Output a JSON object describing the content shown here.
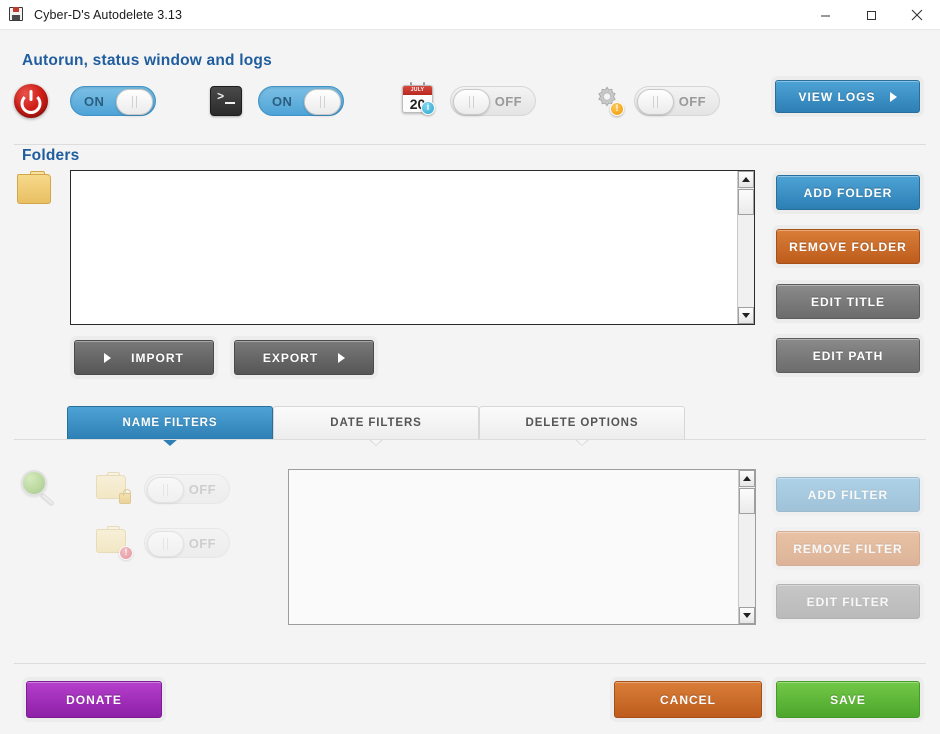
{
  "window": {
    "title": "Cyber-D's Autodelete 3.13",
    "app_icon": "floppy-disk-icon",
    "controls": {
      "minimize": "minimize-icon",
      "maximize": "maximize-icon",
      "close": "close-icon"
    }
  },
  "header": {
    "title": "Autorun, status window and logs",
    "items": [
      {
        "icon": "power-icon",
        "toggle_state": "ON",
        "toggle_label": "ON"
      },
      {
        "icon": "terminal-icon",
        "toggle_state": "ON",
        "toggle_label": "ON"
      },
      {
        "icon": "calendar-icon",
        "toggle_state": "OFF",
        "toggle_label": "OFF",
        "calendar_month": "JULY",
        "calendar_day": "20",
        "badge": "info-badge"
      },
      {
        "icon": "gear-icon",
        "toggle_state": "OFF",
        "toggle_label": "OFF",
        "badge": "warning-badge"
      }
    ],
    "view_logs_label": "VIEW LOGS"
  },
  "folders": {
    "section_title": "Folders",
    "folder_icon": "folder-icon",
    "list_items": [],
    "import_label": "IMPORT",
    "export_label": "EXPORT",
    "buttons": {
      "add_folder": "ADD FOLDER",
      "remove_folder": "REMOVE FOLDER",
      "edit_title": "EDIT TITLE",
      "edit_path": "EDIT PATH"
    }
  },
  "tabs": [
    {
      "label": "NAME FILTERS",
      "active": true
    },
    {
      "label": "DATE FILTERS",
      "active": false
    },
    {
      "label": "DELETE OPTIONS",
      "active": false
    }
  ],
  "filters": {
    "magnifier_icon": "magnifier-icon",
    "rows": [
      {
        "icon": "folder-lock-icon",
        "toggle_state": "OFF",
        "toggle_label": "OFF"
      },
      {
        "icon": "folder-alert-icon",
        "toggle_state": "OFF",
        "toggle_label": "OFF"
      }
    ],
    "list_items": [],
    "buttons": {
      "add_filter": "ADD FILTER",
      "remove_filter": "REMOVE FILTER",
      "edit_filter": "EDIT FILTER"
    }
  },
  "footer": {
    "donate_label": "DONATE",
    "cancel_label": "CANCEL",
    "save_label": "SAVE"
  },
  "colors": {
    "accent_blue": "#2d7fb4",
    "orange": "#bd5c1c",
    "green": "#4da62c",
    "purple": "#8e20a8",
    "heading_blue": "#1f5d9e",
    "background": "#f4f4f4"
  }
}
